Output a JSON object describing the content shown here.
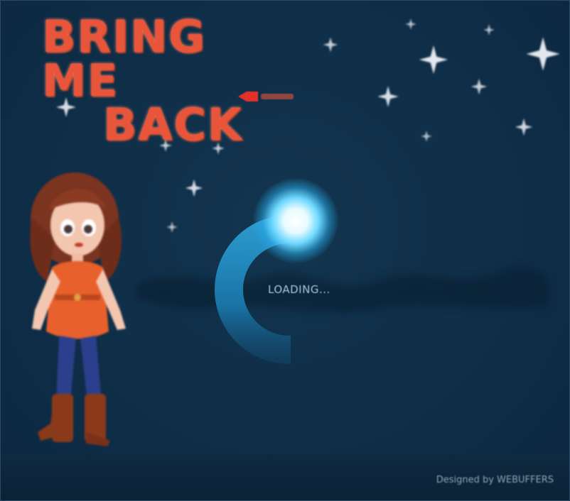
{
  "game": {
    "title_line1": "BRING ME",
    "title_line2": "BACK",
    "loading_label": "LOADING...",
    "credit": "Designed by WEBUFFERS"
  },
  "icons": {
    "stars": "star-icon",
    "title_arrow": "arrow-icon"
  },
  "colors": {
    "background": "#0f2e48",
    "title": "#e8553a",
    "loader_glow": "#6fd8ff",
    "loading_text": "#a9c8dc",
    "footer": "#0b2236"
  }
}
